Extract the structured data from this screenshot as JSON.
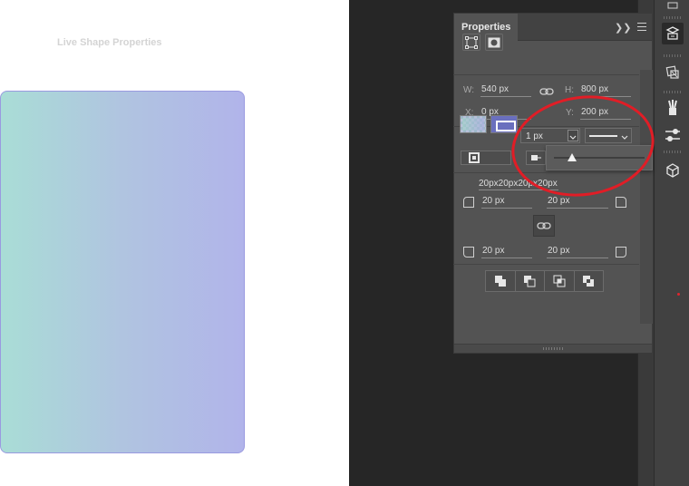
{
  "canvas": {
    "shape": "gradient-rounded-rectangle"
  },
  "properties_panel": {
    "tab_label": "Properties",
    "collapse_icon": "double-chevron-right-icon",
    "menu_icon": "hamburger-menu-icon",
    "header_icons": [
      "bounding-box-icon",
      "mask-icon"
    ],
    "section_title": "Live Shape Properties",
    "transform": {
      "w_label": "W:",
      "w_value": "540 px",
      "h_label": "H:",
      "h_value": "800 px",
      "x_label": "X:",
      "x_value": "0 px",
      "y_label": "Y:",
      "y_value": "200 px"
    },
    "appearance": {
      "fill": "gradient",
      "stroke_color": "#6a6fbe",
      "stroke_width": "1 px",
      "stroke_style": "solid"
    },
    "corners": {
      "summary": "20px20px20px20px",
      "top_left": "20 px",
      "top_right": "20 px",
      "bottom_left": "20 px",
      "bottom_right": "20 px"
    },
    "path_operations": [
      "combine-shapes-icon",
      "subtract-front-shape-icon",
      "intersect-shape-areas-icon",
      "exclude-overlapping-shapes-icon"
    ]
  },
  "stroke_width_slider": {
    "value_fraction": 0.2
  },
  "right_toolbar": {
    "items": [
      "collapse-icon",
      "libraries-icon",
      "properties-icon",
      "adjustments-icon",
      "brushes-icon",
      "paths-icon",
      "3d-icon"
    ]
  },
  "annotation": {
    "color": "#e11d26"
  }
}
